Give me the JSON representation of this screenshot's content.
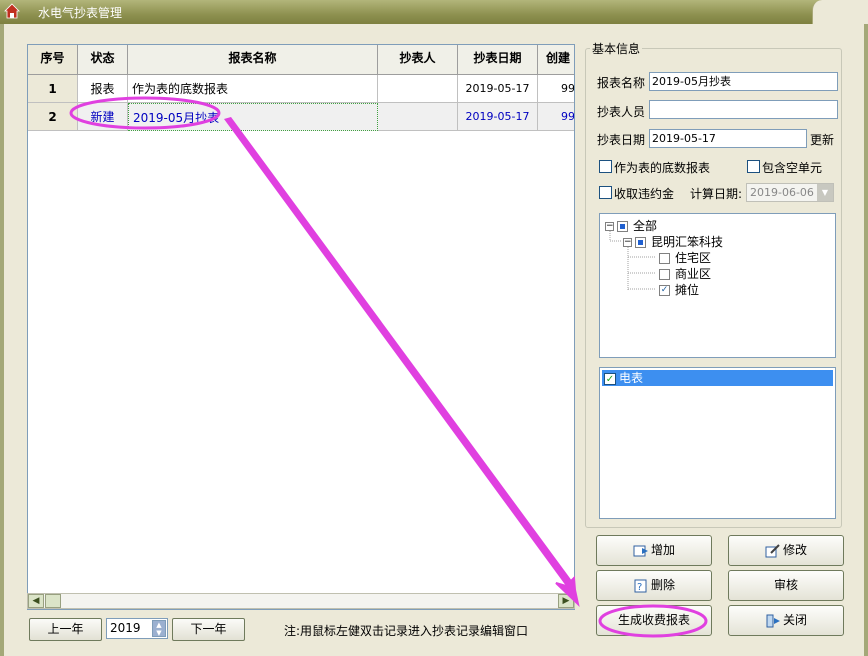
{
  "window": {
    "title": "水电气抄表管理"
  },
  "grid": {
    "columns": [
      "序号",
      "状态",
      "报表名称",
      "抄表人",
      "抄表日期",
      "创建"
    ],
    "rows": [
      {
        "no": "1",
        "status": "报表",
        "name": "作为表的底数报表",
        "reader": "",
        "date": "2019-05-17",
        "created": "99"
      },
      {
        "no": "2",
        "status": "新建",
        "name": "2019-05月抄表",
        "reader": "",
        "date": "2019-05-17",
        "created": "99"
      }
    ]
  },
  "bottom": {
    "prev_year": "上一年",
    "year": "2019",
    "next_year": "下一年",
    "note": "注:用鼠标左健双击记录进入抄表记录编辑窗口"
  },
  "info": {
    "group_title": "基本信息",
    "report_name_label": "报表名称",
    "report_name_value": "2019-05月抄表",
    "reader_label": "抄表人员",
    "reader_value": "",
    "date_label": "抄表日期",
    "date_value": "2019-05-17",
    "update_label": "更新",
    "base_report_label": "作为表的底数报表",
    "include_empty_label": "包含空单元",
    "penalty_label": "收取违约金",
    "calc_date_label": "计算日期:",
    "calc_date_value": "2019-06-06"
  },
  "tree": {
    "root": "全部",
    "company": "昆明汇笨科技",
    "children": [
      {
        "label": "住宅区",
        "checked": false
      },
      {
        "label": "商业区",
        "checked": false
      },
      {
        "label": "摊位",
        "checked": true
      }
    ]
  },
  "meters": {
    "item": "电表"
  },
  "actions": {
    "add": "增加",
    "edit": "修改",
    "delete": "删除",
    "review": "审核",
    "generate": "生成收费报表",
    "close": "关闭"
  },
  "colors": {
    "highlight": "#e040e0",
    "selection": "#3d8ff0"
  }
}
